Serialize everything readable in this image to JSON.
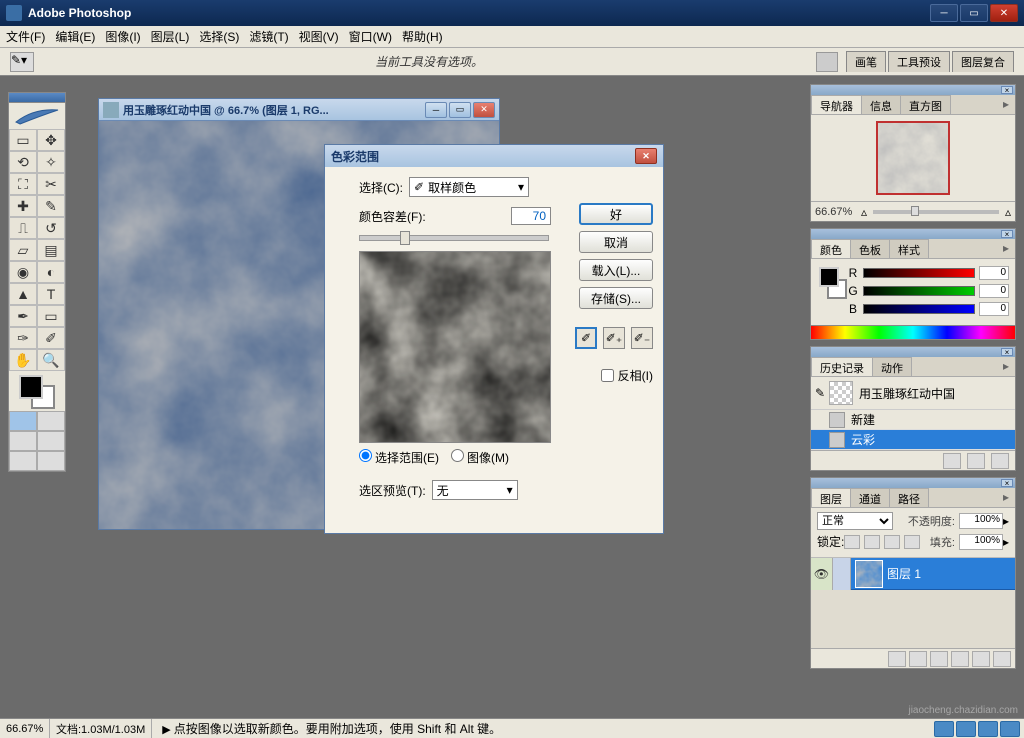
{
  "app": {
    "title": "Adobe Photoshop"
  },
  "menu": {
    "file": "文件(F)",
    "edit": "编辑(E)",
    "image": "图像(I)",
    "layer": "图层(L)",
    "select": "选择(S)",
    "filter": "滤镜(T)",
    "view": "视图(V)",
    "window": "窗口(W)",
    "help": "帮助(H)"
  },
  "optbar": {
    "message": "当前工具没有选项。",
    "tab_brush": "画笔",
    "tab_toolpreset": "工具预设",
    "tab_layercomp": "图层复合"
  },
  "docwin": {
    "title": "用玉雕琢红动中国 @ 66.7% (图层 1, RG..."
  },
  "dialog": {
    "title": "色彩范围",
    "select_label": "选择(C):",
    "select_value": "取样颜色",
    "fuzziness_label": "颜色容差(F):",
    "fuzziness_value": "70",
    "radio_selection": "选择范围(E)",
    "radio_image": "图像(M)",
    "preview_label": "选区预览(T):",
    "preview_value": "无",
    "btn_ok": "好",
    "btn_cancel": "取消",
    "btn_load": "载入(L)...",
    "btn_save": "存储(S)...",
    "invert_label": "反相(I)"
  },
  "navigator": {
    "tab_nav": "导航器",
    "tab_info": "信息",
    "tab_histogram": "直方图",
    "zoom": "66.67%"
  },
  "color": {
    "tab_color": "颜色",
    "tab_swatches": "色板",
    "tab_styles": "样式",
    "r": "R",
    "g": "G",
    "b": "B",
    "r_val": "0",
    "g_val": "0",
    "b_val": "0"
  },
  "history": {
    "tab_history": "历史记录",
    "tab_actions": "动作",
    "snapshot": "用玉雕琢红动中国",
    "step_new": "新建",
    "step_clouds": "云彩"
  },
  "layers": {
    "tab_layers": "图层",
    "tab_channels": "通道",
    "tab_paths": "路径",
    "blend": "正常",
    "opacity_label": "不透明度:",
    "opacity_val": "100%",
    "lock_label": "锁定:",
    "fill_label": "填充:",
    "fill_val": "100%",
    "layer1": "图层 1"
  },
  "status": {
    "zoom": "66.67%",
    "docsize": "文档:1.03M/1.03M",
    "hint": "点按图像以选取新颜色。要用附加选项，使用 Shift 和 Alt 键。"
  },
  "watermark": "jiaocheng.chazidian.com"
}
